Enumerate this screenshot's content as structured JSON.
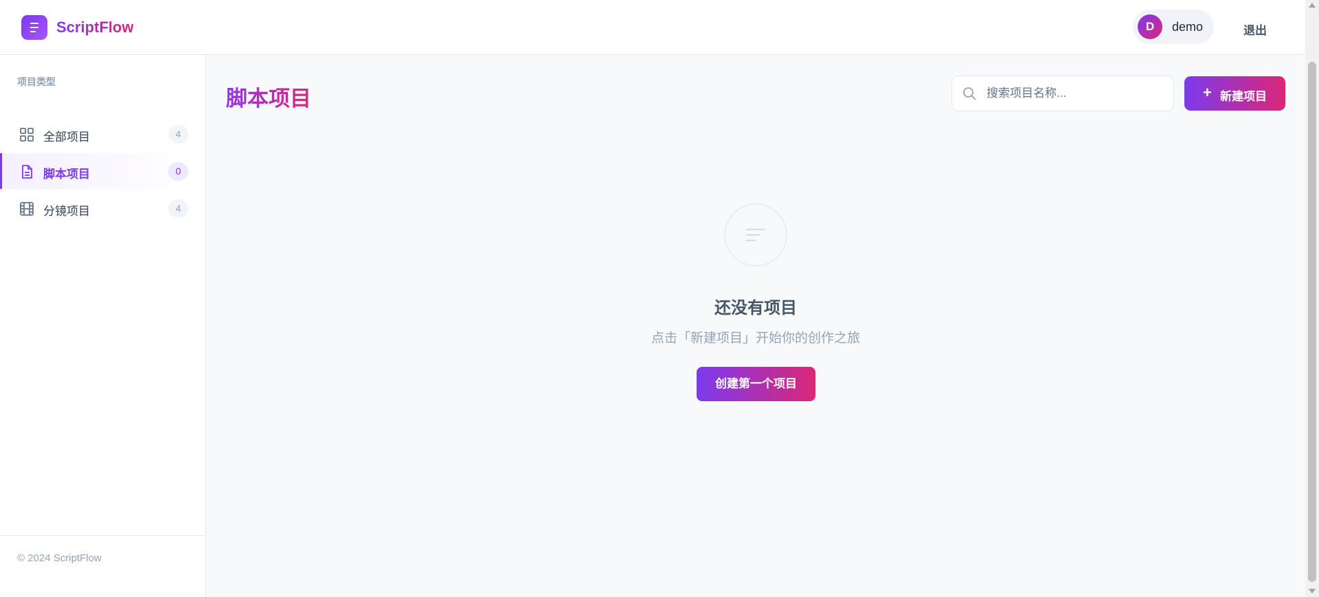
{
  "app": {
    "name": "ScriptFlow"
  },
  "user": {
    "initial": "D",
    "name": "demo",
    "logout_label": "退出"
  },
  "sidebar": {
    "section_title": "项目类型",
    "items": [
      {
        "label": "全部项目",
        "count": "4",
        "icon": "grid-icon",
        "active": false
      },
      {
        "label": "脚本项目",
        "count": "0",
        "icon": "document-icon",
        "active": true
      },
      {
        "label": "分镜项目",
        "count": "4",
        "icon": "film-icon",
        "active": false
      }
    ],
    "footer": "© 2024 ScriptFlow"
  },
  "main": {
    "title": "脚本项目",
    "search": {
      "placeholder": "搜索项目名称...",
      "value": ""
    },
    "new_button_label": "新建项目",
    "empty_state": {
      "icon": "list-lines-icon",
      "title": "还没有项目",
      "description": "点击「新建项目」开始你的创作之旅",
      "cta_label": "创建第一个项目"
    }
  },
  "colors": {
    "accent": "#7c3aed",
    "accent_pink": "#db2777",
    "background": "#f8f9fb",
    "muted_text": "#94a3b8"
  }
}
